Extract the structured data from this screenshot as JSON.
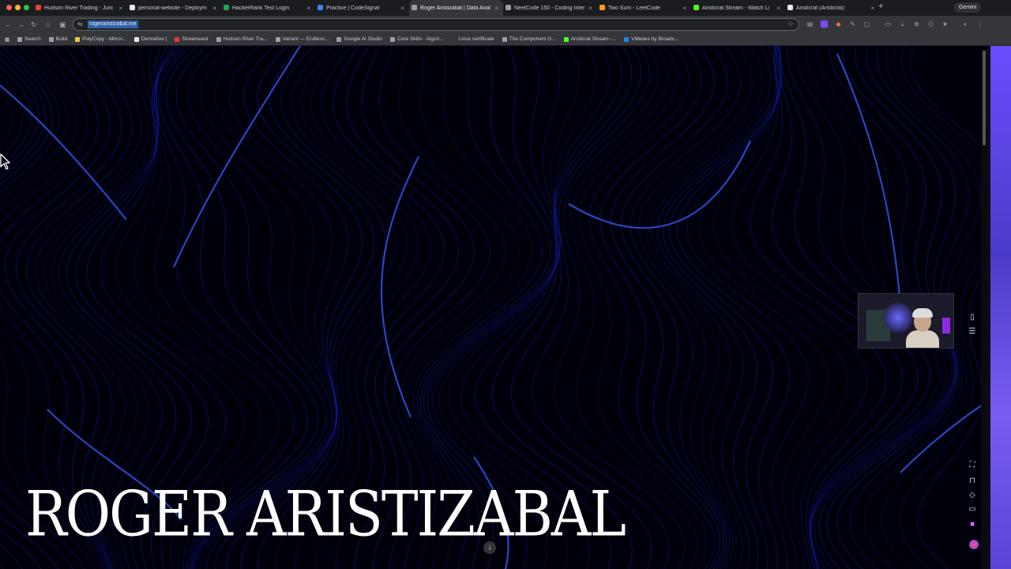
{
  "browser": {
    "tabs": [
      {
        "title": "Hudson River Trading - Juni",
        "icon_color": "#ea4335",
        "active": false
      },
      {
        "title": "personal-website - Deploym",
        "icon_color": "#e8eaed",
        "active": false
      },
      {
        "title": "HackerRank Test Login",
        "icon_color": "#1ba94c",
        "active": false
      },
      {
        "title": "Practice | CodeSignal",
        "icon_color": "#3b82f6",
        "active": false
      },
      {
        "title": "Roger Aristizabal | Data Anal",
        "icon_color": "#9aa0a6",
        "active": true
      },
      {
        "title": "NeetCode 150 - Coding Inter",
        "icon_color": "#9aa0a6",
        "active": false
      },
      {
        "title": "Two Sum - LeetCode",
        "icon_color": "#f89f1b",
        "active": false
      },
      {
        "title": "Aristicrat Stream - Watch Li",
        "icon_color": "#53fc18",
        "active": false
      },
      {
        "title": "Aristicrat (Aristicrat)",
        "icon_color": "#e8eaed",
        "active": false
      }
    ],
    "gemini_label": "Gemini",
    "url": "rogeraristizabal.me",
    "bookmarks": [
      {
        "label": "Search",
        "icon_color": "#9aa0a6"
      },
      {
        "label": "Build",
        "icon_color": "#9aa0a6"
      },
      {
        "label": "PolyCopy - Mirror...",
        "icon_color": "#f5c542"
      },
      {
        "label": "Derivative |",
        "icon_color": "#e8eaed"
      },
      {
        "label": "Streameast",
        "icon_color": "#e53935"
      },
      {
        "label": "Hudson River Tra...",
        "icon_color": "#9aa0a6"
      },
      {
        "label": "Variant — Endless...",
        "icon_color": "#9aa0a6"
      },
      {
        "label": "Google AI Studio",
        "icon_color": "#9aa0a6"
      },
      {
        "label": "Core Skills - Algori...",
        "icon_color": "#9aa0a6"
      },
      {
        "label": "Linux certificate",
        "icon_color": "#35363a"
      },
      {
        "label": "The Component G...",
        "icon_color": "#9aa0a6"
      },
      {
        "label": "Aristicrat Stream -...",
        "icon_color": "#53fc18"
      },
      {
        "label": "VMware by Broadc...",
        "icon_color": "#1e88e5"
      }
    ]
  },
  "page": {
    "hero_name": "ROGER ARISTIZABAL",
    "scroll_down_glyph": "↓"
  },
  "colors": {
    "background": "#00000a",
    "wave_line": "#1a2cff",
    "wave_highlight": "#3a5cff"
  }
}
